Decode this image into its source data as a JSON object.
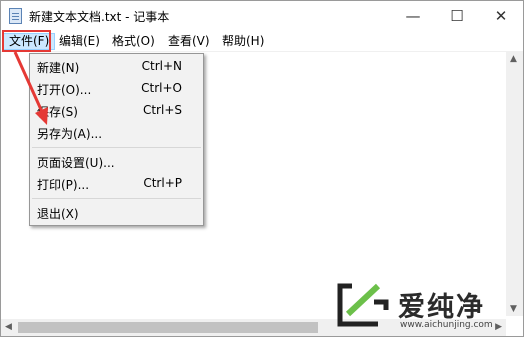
{
  "window": {
    "title": "新建文本文档.txt - 记事本"
  },
  "caption_buttons": {
    "minimize": "—",
    "maximize": "☐",
    "close": "✕"
  },
  "menu": {
    "items": [
      {
        "label": "文件(F)"
      },
      {
        "label": "编辑(E)"
      },
      {
        "label": "格式(O)"
      },
      {
        "label": "查看(V)"
      },
      {
        "label": "帮助(H)"
      }
    ]
  },
  "file_menu": {
    "items": [
      {
        "label": "新建(N)",
        "shortcut": "Ctrl+N"
      },
      {
        "label": "打开(O)...",
        "shortcut": "Ctrl+O"
      },
      {
        "label": "保存(S)",
        "shortcut": "Ctrl+S"
      },
      {
        "label": "另存为(A)...",
        "shortcut": ""
      },
      {
        "label": "页面设置(U)...",
        "shortcut": ""
      },
      {
        "label": "打印(P)...",
        "shortcut": "Ctrl+P"
      },
      {
        "label": "退出(X)",
        "shortcut": ""
      }
    ]
  },
  "scrollbar": {
    "left_arrow": "◀",
    "right_arrow": "▶"
  },
  "watermark": {
    "text": "爱纯净",
    "url": "www.aichunjing.com"
  },
  "colors": {
    "highlight": "#e53935",
    "menu_active": "#cce8ff",
    "dropdown_bg": "#f2f2f2"
  }
}
